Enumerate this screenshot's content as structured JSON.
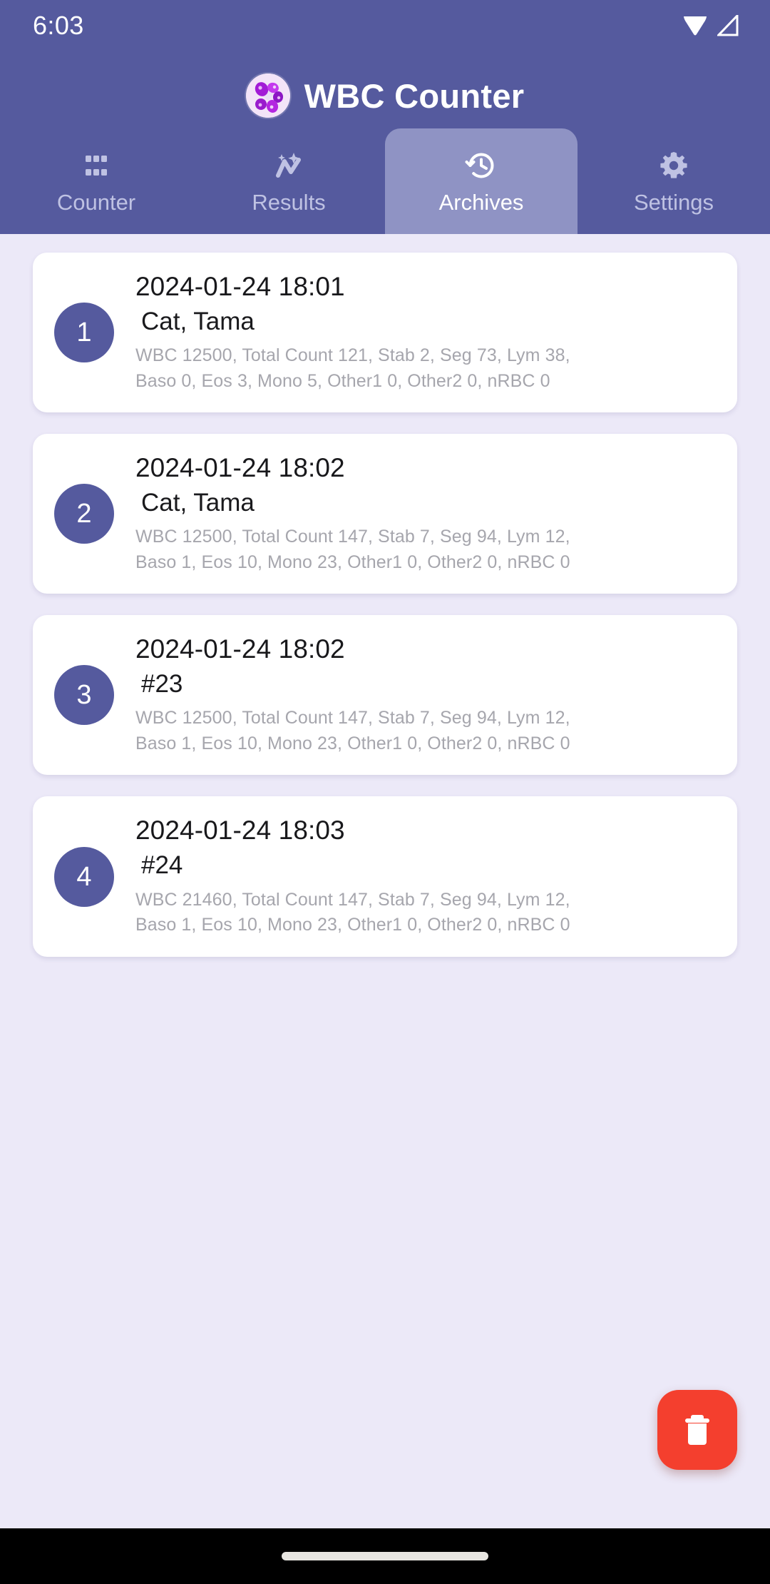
{
  "status_bar": {
    "time": "6:03",
    "icons": [
      "wifi-icon",
      "cellular-signal-icon"
    ]
  },
  "app_bar": {
    "title": "WBC Counter",
    "logo": "blood-smear-logo"
  },
  "tabs": [
    {
      "label": "Counter",
      "icon": "grid-icon",
      "active": false
    },
    {
      "label": "Results",
      "icon": "trending-sparkle-icon",
      "active": false
    },
    {
      "label": "Archives",
      "icon": "history-clock-icon",
      "active": true
    },
    {
      "label": "Settings",
      "icon": "gear-icon",
      "active": false
    }
  ],
  "archives": [
    {
      "index": "1",
      "date": "2024-01-24 18:01",
      "name": "Cat, Tama",
      "detail_line1": "WBC 12500, Total Count 121, Stab 2, Seg 73, Lym 38,",
      "detail_line2": "Baso 0, Eos 3, Mono 5, Other1 0, Other2 0, nRBC 0"
    },
    {
      "index": "2",
      "date": "2024-01-24 18:02",
      "name": "Cat, Tama",
      "detail_line1": "WBC 12500, Total Count 147, Stab 7, Seg 94, Lym 12,",
      "detail_line2": "Baso 1, Eos 10, Mono 23, Other1 0, Other2 0, nRBC 0"
    },
    {
      "index": "3",
      "date": "2024-01-24 18:02",
      "name": "#23",
      "detail_line1": "WBC 12500, Total Count 147, Stab 7, Seg 94, Lym 12,",
      "detail_line2": "Baso 1, Eos 10, Mono 23, Other1 0, Other2 0, nRBC 0"
    },
    {
      "index": "4",
      "date": "2024-01-24 18:03",
      "name": "#24",
      "detail_line1": "WBC 21460, Total Count 147, Stab 7, Seg 94, Lym 12,",
      "detail_line2": "Baso 1, Eos 10, Mono 23, Other1 0, Other2 0, nRBC 0"
    }
  ],
  "fab": {
    "name": "delete-all-button",
    "icon": "trash-icon"
  },
  "colors": {
    "header": "#555A9E",
    "tab_active": "#8F93C4",
    "page_background": "#ECE9F8",
    "card": "#FFFFFF",
    "badge": "#555A9E",
    "fab": "#F43F2E",
    "detail_text": "#A6A6AD"
  }
}
